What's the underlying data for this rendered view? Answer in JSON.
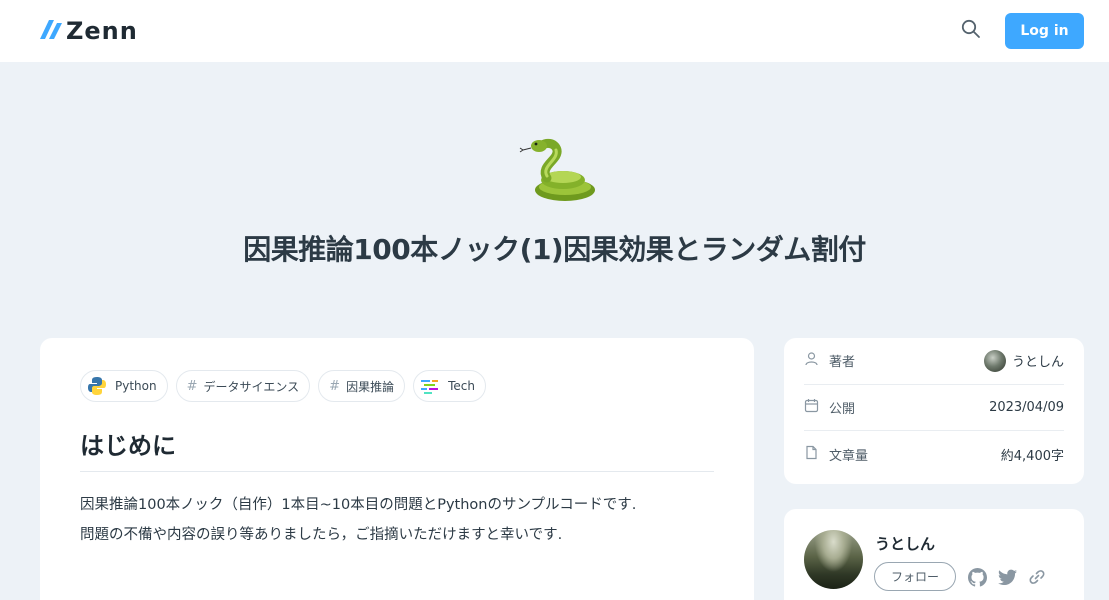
{
  "header": {
    "logo_text": "Zenn",
    "logo_icon": "zenn-logo-icon",
    "search_icon": "search-icon",
    "login_label": "Log in",
    "accent_color": "#3ea8ff"
  },
  "article": {
    "emoji": "snake-emoji",
    "title": "因果推論100本ノック(1)因果効果とランダム割付",
    "topics": [
      {
        "label": "Python",
        "icon": "python-icon"
      },
      {
        "label": "データサイエンス",
        "icon": "hash"
      },
      {
        "label": "因果推論",
        "icon": "hash"
      },
      {
        "label": "Tech",
        "icon": "tech-icon"
      }
    ],
    "hash_mark": "#",
    "heading": "はじめに",
    "paragraph_lines": [
      "因果推論100本ノック（自作）1本目~10本目の問題とPythonのサンプルコードです.",
      "問題の不備や内容の誤り等ありましたら，ご指摘いただけますと幸いです."
    ]
  },
  "info": {
    "rows": [
      {
        "label": "著者",
        "icon": "user-icon",
        "value": "うとしん"
      },
      {
        "label": "公開",
        "icon": "calendar-icon",
        "value": "2023/04/09"
      },
      {
        "label": "文章量",
        "icon": "document-icon",
        "value": "約4,400字"
      }
    ]
  },
  "author": {
    "name": "うとしん",
    "follow_label": "フォロー",
    "social_icons": [
      "github-icon",
      "twitter-icon",
      "link-icon"
    ]
  }
}
